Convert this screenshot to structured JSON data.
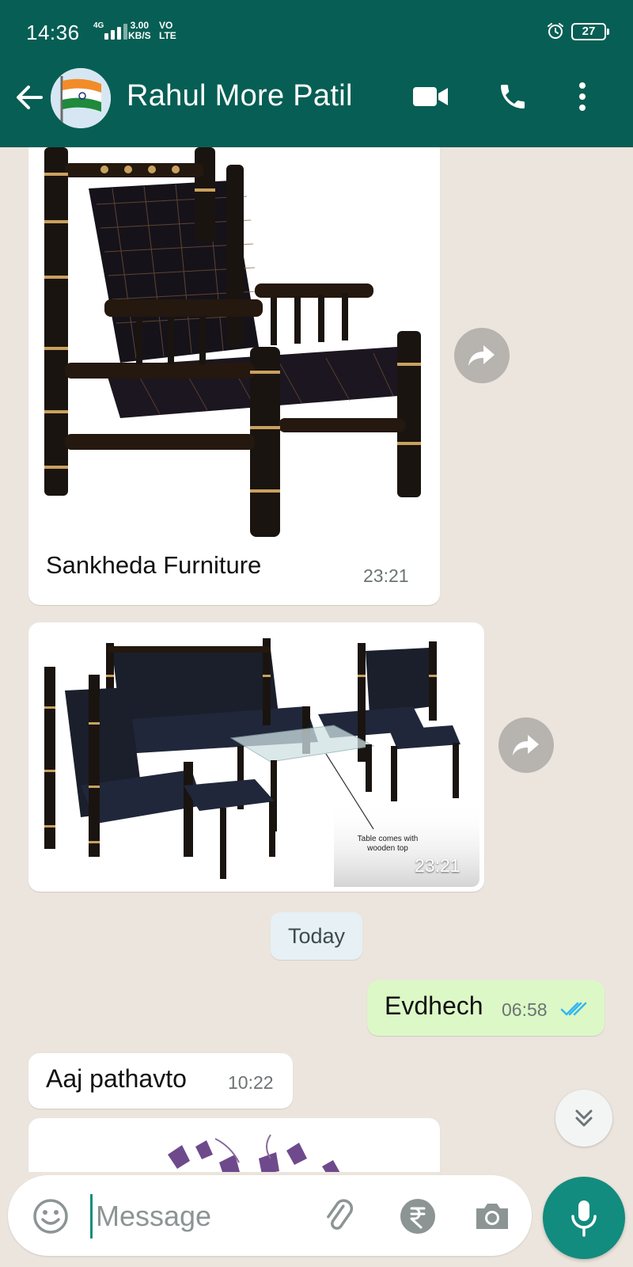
{
  "status_bar": {
    "time": "14:36",
    "network": "4G",
    "speed_value": "3.00",
    "speed_unit": "KB/S",
    "volte_top": "VO",
    "volte_bottom": "LTE",
    "battery": "27"
  },
  "header": {
    "contact_name": "Rahul More Patil",
    "back_icon": "arrow-left-icon",
    "video_icon": "video-call-icon",
    "call_icon": "phone-icon",
    "menu_icon": "more-vertical-icon"
  },
  "messages": [
    {
      "type": "image",
      "direction": "in",
      "image_label": "Sankheda chair",
      "caption": "Sankheda Furniture",
      "time": "23:21"
    },
    {
      "type": "image",
      "direction": "in",
      "image_label": "Sankheda sofa set",
      "overlay_note_line1": "Table comes with",
      "overlay_note_line2": "wooden top",
      "time": "23:21"
    },
    {
      "type": "date",
      "label": "Today"
    },
    {
      "type": "text",
      "direction": "out",
      "text": "Evdhech",
      "time": "06:58",
      "read": true
    },
    {
      "type": "text",
      "direction": "in",
      "text": "Aaj pathavto",
      "time": "10:22"
    },
    {
      "type": "image",
      "direction": "in",
      "image_label": "partially visible image"
    }
  ],
  "input_bar": {
    "placeholder": "Message",
    "emoji_icon": "emoji-icon",
    "attach_icon": "paperclip-icon",
    "payment_icon": "rupee-icon",
    "camera_icon": "camera-icon",
    "mic_icon": "mic-icon"
  },
  "colors": {
    "header": "#075e54",
    "accent": "#128c7e",
    "chat_bg": "#ece5dd",
    "outgoing_bubble": "#dcf8c6",
    "read_ticks": "#34b7f1"
  }
}
